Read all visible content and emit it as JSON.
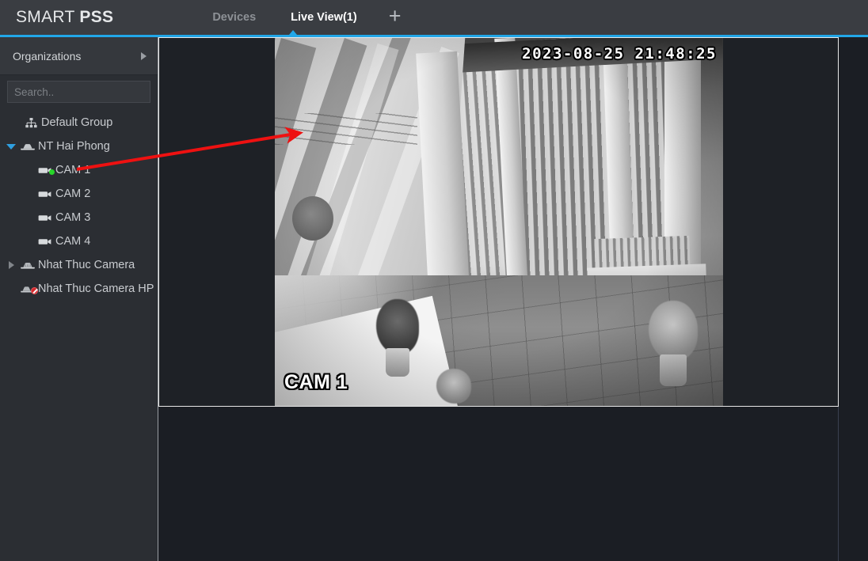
{
  "header": {
    "logo_light": "SMART ",
    "logo_bold": "PSS",
    "tabs": [
      {
        "label": "Devices",
        "active": false
      },
      {
        "label": "Live View(1)",
        "active": true
      }
    ],
    "add_tab_label": "+",
    "accent_color": "#22a7e8"
  },
  "sidebar": {
    "organizations_label": "Organizations",
    "organizations_chevron": "chevron-right-icon",
    "search": {
      "placeholder": "Search..",
      "value": "",
      "icon": "search-icon"
    },
    "tree": [
      {
        "label": "Default Group",
        "icon": "org-chart-icon",
        "level": 0,
        "twisty": "none",
        "status": "none"
      },
      {
        "label": "NT Hai Phong",
        "icon": "nvr-device-icon",
        "level": 1,
        "twisty": "expanded",
        "status": "none"
      },
      {
        "label": "CAM 1",
        "icon": "camera-icon",
        "level": 2,
        "twisty": "none",
        "status": "online"
      },
      {
        "label": "CAM 2",
        "icon": "camera-icon",
        "level": 2,
        "twisty": "none",
        "status": "none"
      },
      {
        "label": "CAM 3",
        "icon": "camera-icon",
        "level": 2,
        "twisty": "none",
        "status": "none"
      },
      {
        "label": "CAM 4",
        "icon": "camera-icon",
        "level": 2,
        "twisty": "none",
        "status": "none"
      },
      {
        "label": "Nhat Thuc Camera",
        "icon": "nvr-device-icon",
        "level": 1,
        "twisty": "collapsed",
        "status": "none"
      },
      {
        "label": "Nhat Thuc Camera HP",
        "icon": "nvr-device-icon",
        "level": 1,
        "twisty": "none",
        "status": "offline"
      }
    ]
  },
  "video": {
    "pane_selected": true,
    "timestamp": "2023-08-25 21:48:25",
    "camera_label": "CAM 1",
    "scene_description": "grayscale night-vision view of a white picket gate and tiled courtyard floor"
  },
  "annotation": {
    "type": "arrow",
    "color": "#ee1111",
    "from_label": "CAM 1",
    "to_label": "video-pane"
  }
}
